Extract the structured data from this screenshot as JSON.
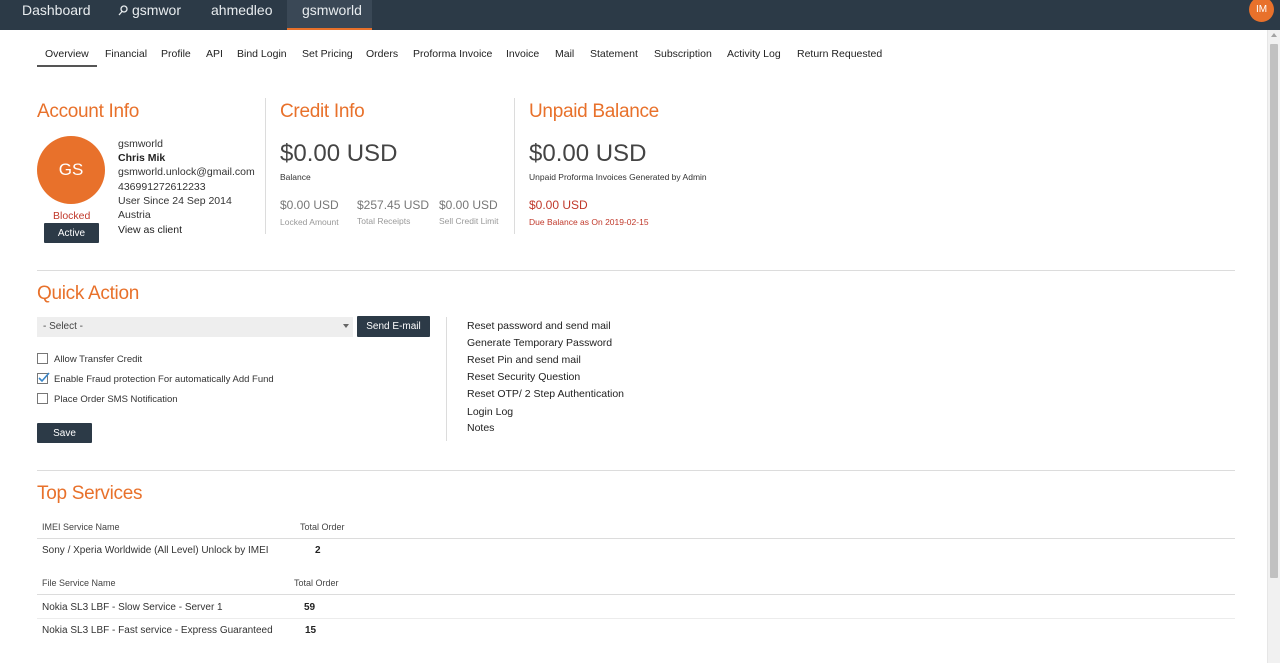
{
  "topbar": {
    "tabs": [
      {
        "label": "Dashboard"
      },
      {
        "label": "gsmwor"
      },
      {
        "label": "ahmedleo"
      },
      {
        "label": "gsmworld"
      }
    ],
    "user_initials": "IM",
    "accent": "#e8712b",
    "bar_color": "#2c3a47"
  },
  "subtabs": [
    "Overview",
    "Financial",
    "Profile",
    "API",
    "Bind Login",
    "Set Pricing",
    "Orders",
    "Proforma Invoice",
    "Invoice",
    "Mail",
    "Statement",
    "Subscription",
    "Activity Log",
    "Return Requested"
  ],
  "account": {
    "title": "Account Info",
    "initials": "GS",
    "status": "Blocked",
    "active_button": "Active",
    "username": "gsmworld",
    "name": "Chris Mik",
    "email": "gsmworld.unlock@gmail.com",
    "phone": "436991272612233",
    "since": "User Since 24 Sep 2014",
    "country": "Austria",
    "view_as_client": "View as client"
  },
  "credit": {
    "title": "Credit Info",
    "balance": "$0.00 USD",
    "balance_label": "Balance",
    "locked_amount": "$0.00 USD",
    "locked_label": "Locked Amount",
    "total_receipts": "$257.45 USD",
    "receipts_label": "Total Receipts",
    "sell_limit": "$0.00 USD",
    "sell_limit_label": "Sell Credit Limit"
  },
  "unpaid": {
    "title": "Unpaid Balance",
    "amount": "$0.00 USD",
    "amount_label": "Unpaid Proforma Invoices Generated by Admin",
    "due_amount": "$0.00 USD",
    "due_label": "Due Balance as On 2019-02-15"
  },
  "quick_action": {
    "title": "Quick Action",
    "select_value": "- Select -",
    "send_email": "Send E-mail",
    "checkboxes": [
      {
        "label": "Allow Transfer Credit",
        "checked": false
      },
      {
        "label": "Enable Fraud protection For automatically Add Fund",
        "checked": true
      },
      {
        "label": "Place Order SMS Notification",
        "checked": false
      }
    ],
    "save": "Save",
    "links": [
      "Reset password and send mail",
      "Generate Temporary Password",
      "Reset Pin and send mail",
      "Reset Security Question",
      "Reset OTP/ 2 Step Authentication",
      "Login Log",
      "Notes"
    ]
  },
  "top_services": {
    "title": "Top Services",
    "imei_header": "IMEI Service Name",
    "imei_total_header": "Total Order",
    "imei_rows": [
      {
        "name": "Sony / Xperia Worldwide (All Level) Unlock by IMEI",
        "total": "2"
      }
    ],
    "file_header": "File Service Name",
    "file_total_header": "Total Order",
    "file_rows": [
      {
        "name": "Nokia SL3 LBF - Slow Service - Server 1",
        "total": "59"
      },
      {
        "name": "Nokia SL3 LBF - Fast service - Express Guaranteed",
        "total": "15"
      }
    ]
  }
}
